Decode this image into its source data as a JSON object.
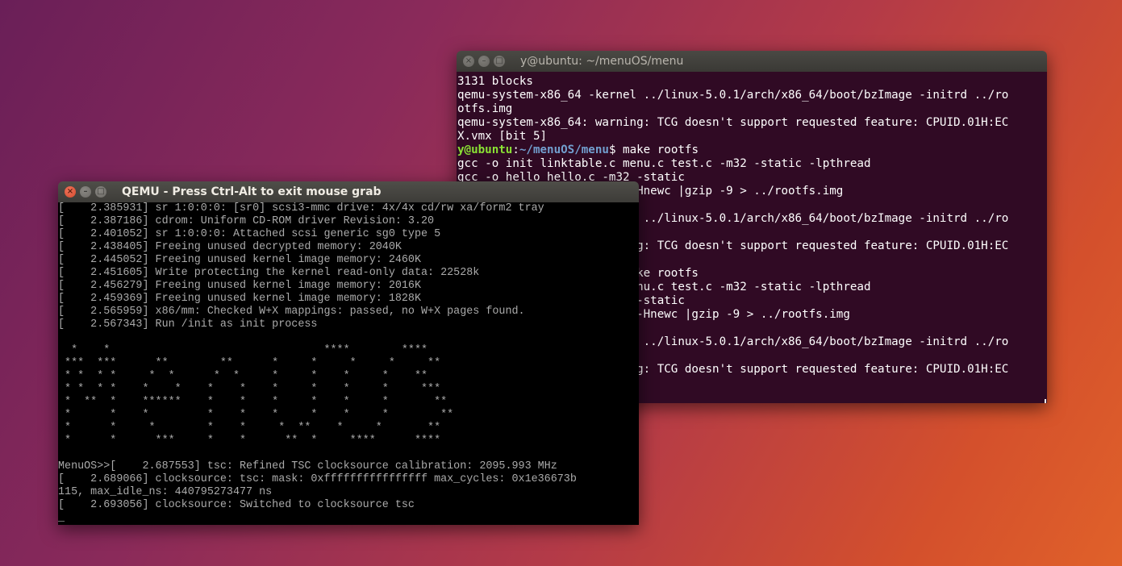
{
  "terminal": {
    "title": "y@ubuntu: ~/menuOS/menu",
    "lines": [
      "3131 blocks",
      "qemu-system-x86_64 -kernel ../linux-5.0.1/arch/x86_64/boot/bzImage -initrd ../ro",
      "otfs.img",
      "qemu-system-x86_64: warning: TCG doesn't support requested feature: CPUID.01H:EC",
      "X.vmx [bit 5]"
    ],
    "prompt": {
      "user": "y@ubuntu",
      "sep": ":",
      "path": "~/menuOS/menu",
      "dollar": "$",
      "command": " make rootfs"
    },
    "lines_after": [
      "gcc -o init linktable.c menu.c test.c -m32 -static -lpthread",
      "gcc -o hello hello.c -m32 -static",
      "                         -Hnewc |gzip -9 > ../rootfs.img",
      "",
      "                         l ../linux-5.0.1/arch/x86_64/boot/bzImage -initrd ../ro",
      "",
      "                         ng: TCG doesn't support requested feature: CPUID.01H:EC",
      "",
      "                         ake rootfs",
      "                         enu.c test.c -m32 -static -lpthread",
      "                          -static",
      "                          -Hnewc |gzip -9 > ../rootfs.img",
      "",
      "                         l ../linux-5.0.1/arch/x86_64/boot/bzImage -initrd ../ro",
      "",
      "                         ng: TCG doesn't support requested feature: CPUID.01H:EC"
    ]
  },
  "qemu": {
    "title": "QEMU - Press Ctrl-Alt to exit mouse grab",
    "lines": [
      "[    2.385931] sr 1:0:0:0: [sr0] scsi3-mmc drive: 4x/4x cd/rw xa/form2 tray",
      "[    2.387186] cdrom: Uniform CD-ROM driver Revision: 3.20",
      "[    2.401052] sr 1:0:0:0: Attached scsi generic sg0 type 5",
      "[    2.438405] Freeing unused decrypted memory: 2040K",
      "[    2.445052] Freeing unused kernel image memory: 2460K",
      "[    2.451605] Write protecting the kernel read-only data: 22528k",
      "[    2.456279] Freeing unused kernel image memory: 2016K",
      "[    2.459369] Freeing unused kernel image memory: 1828K",
      "[    2.565959] x86/mm: Checked W+X mappings: passed, no W+X pages found.",
      "[    2.567343] Run /init as init process",
      "",
      "  *    *                                 ****        ****",
      " ***  ***      **        **      *     *     *     *     **",
      " * *  * *     *  *      *  *     *     *    *     *    **",
      " * *  * *    *    *    *    *    *     *    *     *     ***",
      " *  **  *    ******    *    *    *     *    *     *       **",
      " *      *    *         *    *    *     *    *     *        **",
      " *      *     *        *    *     *  **    *     *       **",
      " *      *      ***     *    *      **  *     ****      ****",
      "",
      "MenuOS>>[    2.687553] tsc: Refined TSC clocksource calibration: 2095.993 MHz",
      "[    2.689066] clocksource: tsc: mask: 0xffffffffffffffff max_cycles: 0x1e36673b",
      "115, max_idle_ns: 440795273477 ns",
      "[    2.693056] clocksource: Switched to clocksource tsc"
    ],
    "cursor": "_"
  }
}
